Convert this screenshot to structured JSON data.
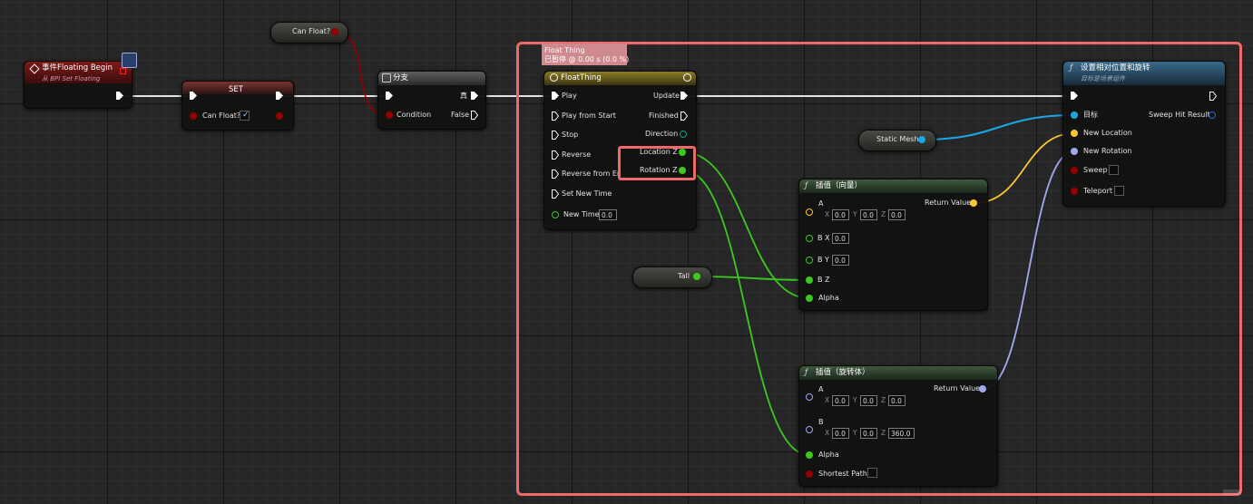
{
  "colors": {
    "exec": "#ffffff",
    "bool": "#940000",
    "float": "#3cc91e",
    "vector": "#fdc82e",
    "rotator": "#a0a8f0",
    "object": "#1aa7e6",
    "struct": "#3066d0",
    "highlight": "#ee6a6a"
  },
  "comment": {
    "title": "Float Thing",
    "subtitle": "已暂停 @ 0.00 s (0.0 %)"
  },
  "nodes": {
    "event": {
      "title": "事件Floating Begin",
      "subtitle": "从 BPI Set Floating"
    },
    "can_float_getter": {
      "label": "Can Float?"
    },
    "set": {
      "title": "SET",
      "pin": "Can Float?"
    },
    "branch": {
      "title": "分支",
      "condition": "Condition",
      "true_glyph": "真",
      "false_label": "False"
    },
    "timeline": {
      "title": "FloatThing",
      "inputs": [
        "Play",
        "Play from Start",
        "Stop",
        "Reverse",
        "Reverse from End",
        "Set New Time",
        "New Time"
      ],
      "new_time": "0.0",
      "outputs": [
        "Update",
        "Finished",
        "Direction",
        "Location Z",
        "Rotation Z"
      ]
    },
    "static_mesh": {
      "label": "Static Mesh"
    },
    "tall": {
      "label": "Tall"
    },
    "lerp_vector": {
      "title": "插值（向量）",
      "a_label": "A",
      "a": {
        "x": "0.0",
        "y": "0.0",
        "z": "0.0"
      },
      "bx_label": "B X",
      "bx": "0.0",
      "by_label": "B Y",
      "by": "0.0",
      "bz_label": "B Z",
      "alpha": "Alpha",
      "return": "Return Value"
    },
    "lerp_rotator": {
      "title": "插值（旋转体）",
      "a_label": "A",
      "a": {
        "x": "0.0",
        "y": "0.0",
        "z": "0.0"
      },
      "b_label": "B",
      "b": {
        "x": "0.0",
        "y": "0.0",
        "z": "360.0"
      },
      "alpha": "Alpha",
      "shortest": "Shortest Path",
      "return": "Return Value"
    },
    "set_rel": {
      "title": "设置相对位置和旋转",
      "subtitle": "目标是场景组件",
      "target": "目标",
      "sweep_hit": "Sweep Hit Result",
      "new_location": "New Location",
      "new_rotation": "New Rotation",
      "sweep": "Sweep",
      "teleport": "Teleport"
    }
  },
  "axis_labels": {
    "x": "X",
    "y": "Y",
    "z": "Z"
  }
}
